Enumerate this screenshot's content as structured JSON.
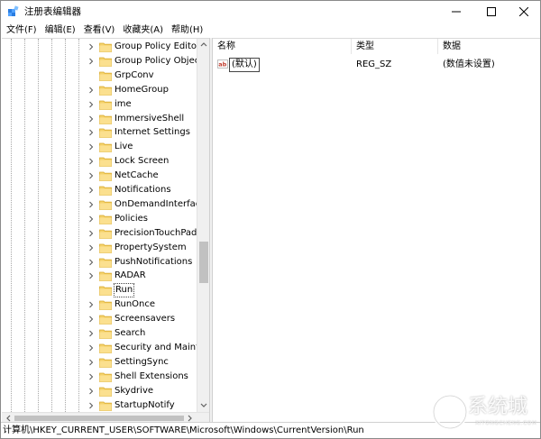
{
  "window": {
    "title": "注册表编辑器",
    "icon": "regedit-icon"
  },
  "menu": [
    {
      "label": "文件(F)"
    },
    {
      "label": "编辑(E)"
    },
    {
      "label": "查看(V)"
    },
    {
      "label": "收藏夹(A)"
    },
    {
      "label": "帮助(H)"
    }
  ],
  "tree": {
    "items": [
      {
        "label": "Group Policy Editor",
        "expandable": true
      },
      {
        "label": "Group Policy Objec",
        "expandable": true
      },
      {
        "label": "GrpConv",
        "expandable": false
      },
      {
        "label": "HomeGroup",
        "expandable": true
      },
      {
        "label": "ime",
        "expandable": true
      },
      {
        "label": "ImmersiveShell",
        "expandable": true
      },
      {
        "label": "Internet Settings",
        "expandable": true
      },
      {
        "label": "Live",
        "expandable": true
      },
      {
        "label": "Lock Screen",
        "expandable": true
      },
      {
        "label": "NetCache",
        "expandable": true
      },
      {
        "label": "Notifications",
        "expandable": true
      },
      {
        "label": "OnDemandInterface",
        "expandable": true
      },
      {
        "label": "Policies",
        "expandable": true
      },
      {
        "label": "PrecisionTouchPad",
        "expandable": true
      },
      {
        "label": "PropertySystem",
        "expandable": true
      },
      {
        "label": "PushNotifications",
        "expandable": true
      },
      {
        "label": "RADAR",
        "expandable": true
      },
      {
        "label": "Run",
        "expandable": false,
        "selected": true
      },
      {
        "label": "RunOnce",
        "expandable": true
      },
      {
        "label": "Screensavers",
        "expandable": true
      },
      {
        "label": "Search",
        "expandable": true
      },
      {
        "label": "Security and Mainte",
        "expandable": true
      },
      {
        "label": "SettingSync",
        "expandable": true
      },
      {
        "label": "Shell Extensions",
        "expandable": true
      },
      {
        "label": "Skydrive",
        "expandable": true
      },
      {
        "label": "StartupNotify",
        "expandable": true
      }
    ],
    "scroll_position": 0.62
  },
  "values": {
    "columns": {
      "name": "名称",
      "type": "类型",
      "data": "数据"
    },
    "rows": [
      {
        "name": "(默认)",
        "type": "REG_SZ",
        "data": "(数值未设置)",
        "icon": "string-value-icon"
      }
    ]
  },
  "statusbar": {
    "path": "计算机\\HKEY_CURRENT_USER\\SOFTWARE\\Microsoft\\Windows\\CurrentVersion\\Run"
  },
  "watermark": {
    "name": "系统城",
    "domain": "XITONGCHENG.COM"
  },
  "colors": {
    "folder": "#f5d26b",
    "folder_edge": "#d9aa2e",
    "accent": "#1f6fd1"
  }
}
